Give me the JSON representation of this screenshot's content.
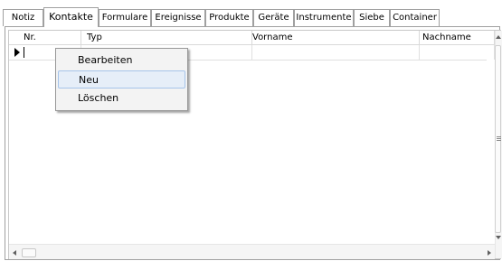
{
  "tabs": [
    {
      "label": "Notiz",
      "active": false
    },
    {
      "label": "Kontakte",
      "active": true
    },
    {
      "label": "Formulare",
      "active": false
    },
    {
      "label": "Ereignisse",
      "active": false
    },
    {
      "label": "Produkte",
      "active": false
    },
    {
      "label": "Geräte",
      "active": false
    },
    {
      "label": "Instrumente",
      "active": false
    },
    {
      "label": "Siebe",
      "active": false
    },
    {
      "label": "Container",
      "active": false
    }
  ],
  "grid": {
    "columns": [
      "Nr.",
      "Typ",
      "Vorname",
      "Nachname"
    ],
    "rows": [
      {
        "nr": "",
        "typ": "",
        "vorname": "",
        "nachname": "",
        "editing": true
      }
    ]
  },
  "context_menu": {
    "items": [
      {
        "label": "Bearbeiten",
        "selected": false
      },
      {
        "label": "Neu",
        "selected": true
      },
      {
        "label": "Löschen",
        "selected": false
      }
    ]
  },
  "colors": {
    "border": "#a0a0a0",
    "menu_bg": "#f3f3f3",
    "menu_highlight": "#e6eef8",
    "menu_highlight_border": "#a6c4ea"
  }
}
